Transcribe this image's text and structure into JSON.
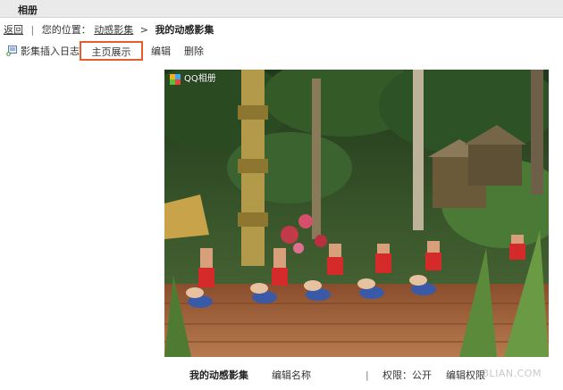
{
  "window": {
    "title": "相册"
  },
  "breadcrumb": {
    "back": "返回",
    "separator": "|",
    "location_label": "您的位置：",
    "parent": "动感影集",
    "chevron": ">",
    "current": "我的动感影集"
  },
  "toolbar": {
    "insert_label": "影集插入日志",
    "home_label": "主页展示",
    "edit_label": "编辑",
    "delete_label": "删除"
  },
  "photo": {
    "badge": "QQ相册",
    "icon": "album-photo"
  },
  "footer": {
    "album_name": "我的动感影集",
    "edit_name": "编辑名称",
    "separator": "|",
    "permission": "权限：公开",
    "permission_action": "编辑权限",
    "watermark": "3LIAN.COM"
  },
  "colors": {
    "highlight": "#e85b2a",
    "titlebar": "#eaeaea"
  }
}
